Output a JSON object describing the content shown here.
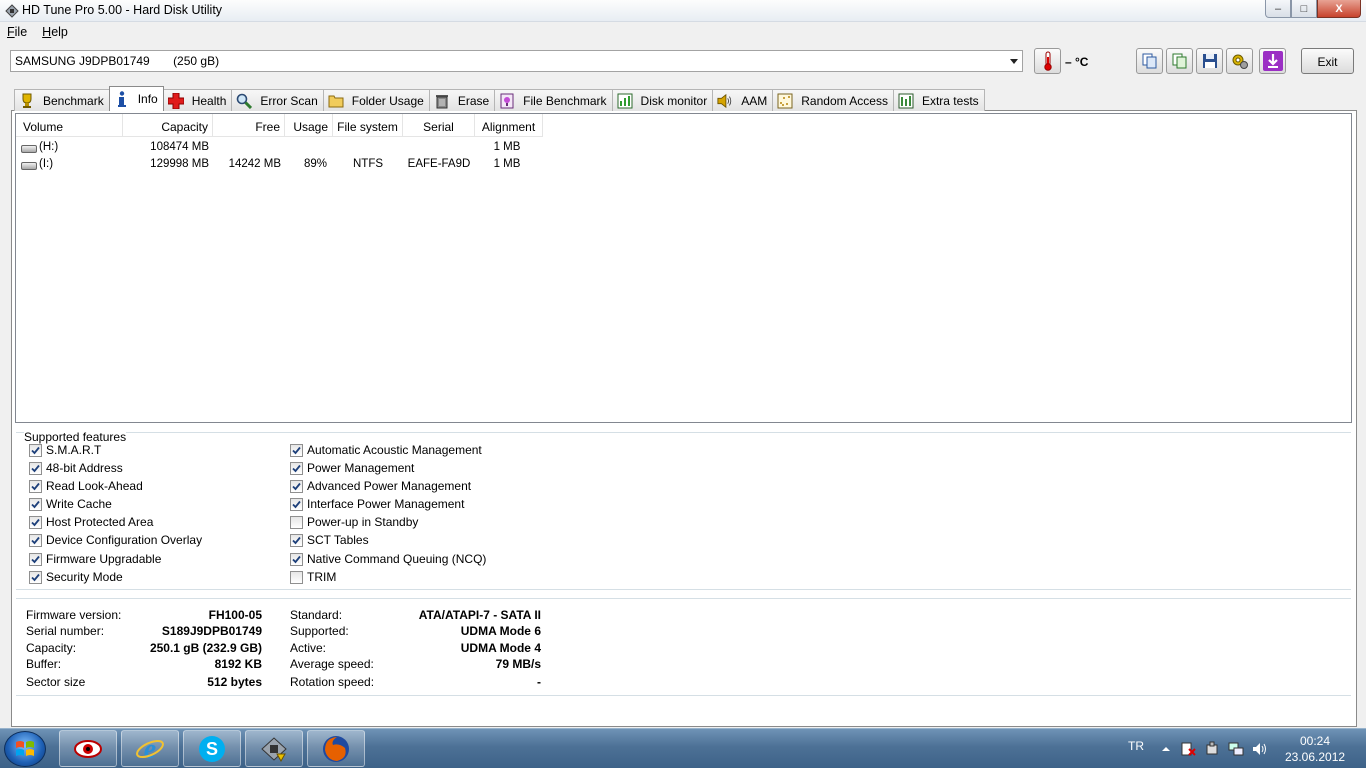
{
  "window": {
    "title": "HD Tune Pro 5.00 - Hard Disk Utility",
    "minimize": "–",
    "maximize": "□",
    "close": "X"
  },
  "menu": [
    {
      "label": "File",
      "underline": "F",
      "rest": "ile"
    },
    {
      "label": "Help",
      "underline": "H",
      "rest": "elp"
    }
  ],
  "toolbar": {
    "drive": "SAMSUNG J9DPB01749       (250 gB)",
    "temperature": "– °C",
    "exit_label": "Exit"
  },
  "tabs": [
    {
      "label": "Benchmark",
      "icon": "benchmark-icon"
    },
    {
      "label": "Info",
      "icon": "info-icon",
      "active": true
    },
    {
      "label": "Health",
      "icon": "health-cross-icon"
    },
    {
      "label": "Error Scan",
      "icon": "magnifier-icon"
    },
    {
      "label": "Folder Usage",
      "icon": "folder-icon"
    },
    {
      "label": "Erase",
      "icon": "trash-icon"
    },
    {
      "label": "File Benchmark",
      "icon": "file-benchmark-icon"
    },
    {
      "label": "Disk monitor",
      "icon": "monitor-chart-icon"
    },
    {
      "label": "AAM",
      "icon": "speaker-icon"
    },
    {
      "label": "Random Access",
      "icon": "random-access-icon"
    },
    {
      "label": "Extra tests",
      "icon": "extra-tests-icon"
    }
  ],
  "volumes": {
    "columns": [
      "Volume",
      "Capacity",
      "Free",
      "Usage",
      "File system",
      "Serial",
      "Alignment"
    ],
    "rows": [
      {
        "volume": "(H:)",
        "capacity": "108474 MB",
        "free": "",
        "usage": "",
        "fs": "",
        "serial": "",
        "alignment": "1 MB"
      },
      {
        "volume": "(I:)",
        "capacity": "129998 MB",
        "free": "14242 MB",
        "usage": "89%",
        "fs": "NTFS",
        "serial": "EAFE-FA9D",
        "alignment": "1 MB"
      }
    ]
  },
  "features": {
    "title": "Supported features",
    "left": [
      {
        "label": "S.M.A.R.T",
        "checked": true
      },
      {
        "label": "48-bit Address",
        "checked": true
      },
      {
        "label": "Read Look-Ahead",
        "checked": true
      },
      {
        "label": "Write Cache",
        "checked": true
      },
      {
        "label": "Host Protected Area",
        "checked": true
      },
      {
        "label": "Device Configuration Overlay",
        "checked": true
      },
      {
        "label": "Firmware Upgradable",
        "checked": true
      },
      {
        "label": "Security Mode",
        "checked": true
      }
    ],
    "right": [
      {
        "label": "Automatic Acoustic Management",
        "checked": true
      },
      {
        "label": "Power Management",
        "checked": true
      },
      {
        "label": "Advanced Power Management",
        "checked": true
      },
      {
        "label": "Interface Power Management",
        "checked": true
      },
      {
        "label": "Power-up in Standby",
        "checked": false
      },
      {
        "label": "SCT Tables",
        "checked": true
      },
      {
        "label": "Native Command Queuing (NCQ)",
        "checked": true
      },
      {
        "label": "TRIM",
        "checked": false
      }
    ]
  },
  "info": {
    "left": [
      {
        "label": "Firmware version:",
        "value": "FH100-05"
      },
      {
        "label": "Serial number:",
        "value": "S189J9DPB01749"
      },
      {
        "label": "Capacity:",
        "value": "250.1 gB (232.9 GB)"
      },
      {
        "label": "Buffer:",
        "value": "8192 KB"
      },
      {
        "label": "Sector size",
        "value": "512 bytes"
      }
    ],
    "right": [
      {
        "label": "Standard:",
        "value": "ATA/ATAPI-7 - SATA II"
      },
      {
        "label": "Supported:",
        "value": "UDMA Mode 6"
      },
      {
        "label": "Active:",
        "value": "UDMA Mode 4"
      },
      {
        "label": "Average speed:",
        "value": "79 MB/s"
      },
      {
        "label": "Rotation speed:",
        "value": "-"
      }
    ]
  },
  "taskbar": {
    "language": "TR",
    "time": "00:24",
    "date": "23.06.2012"
  }
}
